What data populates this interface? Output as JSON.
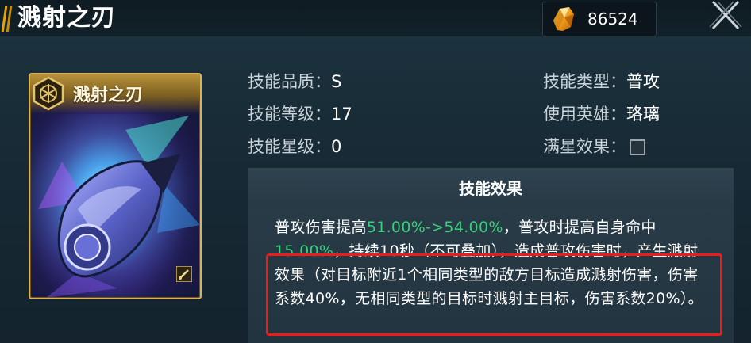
{
  "header": {
    "title": "溅射之刃",
    "currency_icon": "amber-crystal-icon",
    "currency_amount": "86524",
    "close_icon": "close-icon"
  },
  "card": {
    "name": "溅射之刃",
    "emblem_icon": "hexagon-emblem-icon",
    "art_icon": "blade-gauntlet-art",
    "badge_icon": "brush-icon"
  },
  "stats_left": [
    {
      "label": "技能品质：",
      "value": "S"
    },
    {
      "label": "技能等级：",
      "value": "17"
    },
    {
      "label": "技能星级：",
      "value": "0"
    }
  ],
  "stats_right": [
    {
      "label": "技能类型：",
      "value": "普攻"
    },
    {
      "label": "使用英雄：",
      "value": "珞璃"
    },
    {
      "label": "满星效果：",
      "value": ""
    }
  ],
  "full_star_checked": false,
  "effect": {
    "title": "技能效果",
    "seg1": "普攻伤害提高",
    "seg2": "51.00%->54.00%",
    "seg3": "，普攻时提高自身命中",
    "seg4": "15.00%",
    "seg5": "，持续10秒（不可叠加），造成普攻伤害时，产生",
    "seg6": "溅射效果（对目标附近1个相同类型的敌方目标造成溅射伤害，伤害系数40%，无相同类型的目标时溅射主目标，伤害系数20%）。"
  },
  "colors": {
    "highlight_green": "#35d07a",
    "annotation_red": "#ee1b1b",
    "card_gold": "#d7b45a",
    "accent_orange": "#e8a400"
  }
}
